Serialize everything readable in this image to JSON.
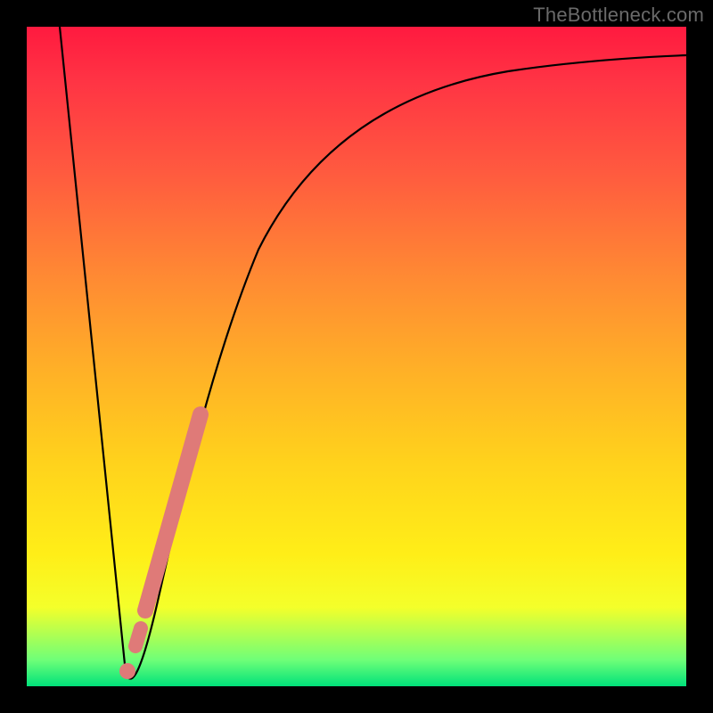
{
  "watermark": "TheBottleneck.com",
  "colors": {
    "background": "#000000",
    "curve": "#000000",
    "highlight": "#e07070"
  },
  "chart_data": {
    "type": "line",
    "title": "",
    "xlabel": "",
    "ylabel": "",
    "xlim": [
      0,
      100
    ],
    "ylim": [
      0,
      100
    ],
    "grid": false,
    "legend": false,
    "series": [
      {
        "name": "bottleneck-curve",
        "x": [
          5,
          8,
          10,
          12,
          14,
          15,
          16,
          18,
          20,
          22,
          25,
          28,
          32,
          36,
          40,
          45,
          50,
          55,
          60,
          65,
          70,
          75,
          80,
          85,
          90,
          95,
          100
        ],
        "y": [
          100,
          72,
          52,
          32,
          12,
          2,
          4,
          18,
          32,
          44,
          56,
          64,
          72,
          78,
          82,
          86,
          89,
          91,
          92.5,
          93.5,
          94.3,
          95,
          95.5,
          95.8,
          96,
          96.2,
          96.4
        ]
      }
    ],
    "annotations": [
      {
        "name": "highlight-segment",
        "x": [
          17,
          26
        ],
        "y": [
          10,
          58
        ]
      },
      {
        "name": "highlight-dot",
        "x": [
          15.5
        ],
        "y": [
          2.5
        ]
      }
    ]
  }
}
